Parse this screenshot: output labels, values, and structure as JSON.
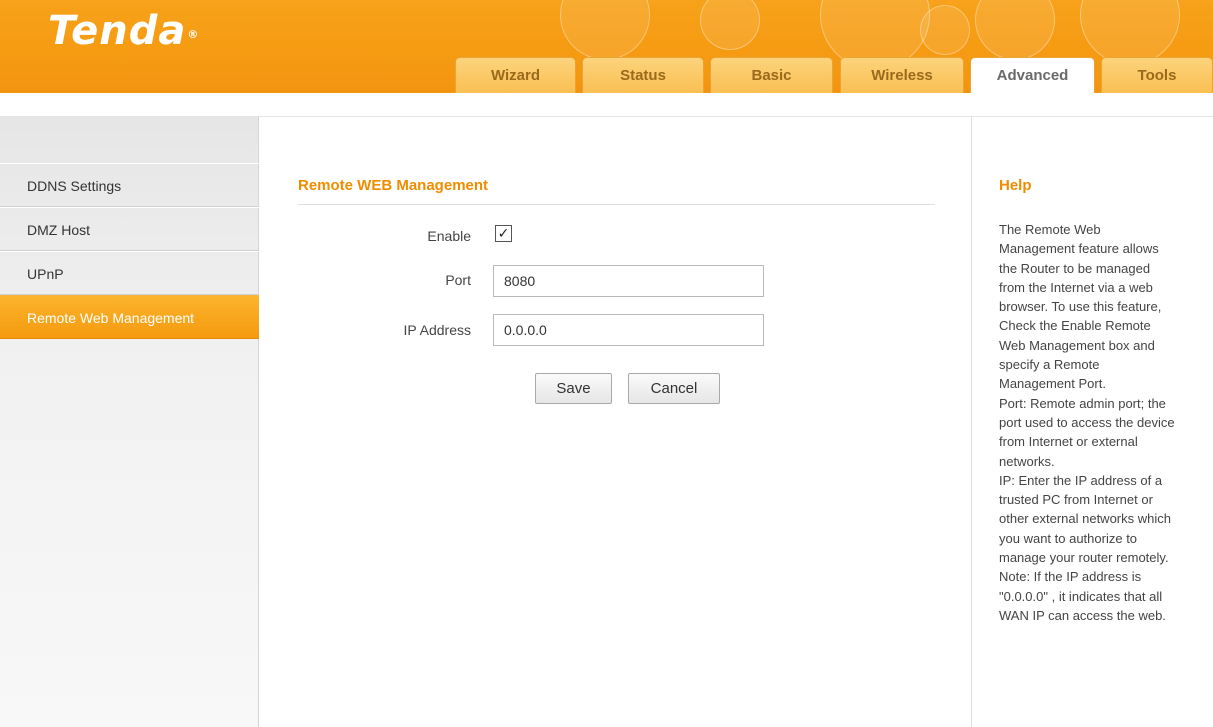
{
  "brand": {
    "logo_text": "Tenda",
    "logo_mark": "®"
  },
  "nav": {
    "tabs": [
      {
        "label": "Wizard",
        "active": false
      },
      {
        "label": "Status",
        "active": false
      },
      {
        "label": "Basic",
        "active": false
      },
      {
        "label": "Wireless",
        "active": false
      },
      {
        "label": "Advanced",
        "active": true
      },
      {
        "label": "Tools",
        "active": false
      }
    ]
  },
  "sidebar": {
    "items": [
      {
        "label": "DDNS Settings",
        "active": false
      },
      {
        "label": "DMZ Host",
        "active": false
      },
      {
        "label": "UPnP",
        "active": false
      },
      {
        "label": "Remote Web Management",
        "active": true
      }
    ]
  },
  "main": {
    "title": "Remote WEB Management",
    "enable_label": "Enable",
    "enable_checked": true,
    "enable_mark": "✓",
    "port_label": "Port",
    "port_value": "8080",
    "ip_label": "IP Address",
    "ip_value": "0.0.0.0",
    "save_label": "Save",
    "cancel_label": "Cancel"
  },
  "help": {
    "title": "Help",
    "text": "The Remote Web\nManagement feature allows\nthe Router to be managed\nfrom the Internet via a web\nbrowser. To use this feature,\nCheck the Enable Remote\nWeb Management box and\nspecify a Remote\nManagement Port.\nPort: Remote admin port; the\nport used to access the device\nfrom Internet or external\nnetworks.\nIP: Enter the IP address of a\ntrusted PC from Internet or\nother external networks which\nyou want to authorize to\nmanage your router remotely.\nNote: If the IP address is\n\"0.0.0.0\" , it indicates that all\nWAN IP can access the web."
  },
  "colors": {
    "accent": "#f08c00",
    "header_orange": "#f59b12",
    "sidebar_active": "#f7a51c"
  }
}
